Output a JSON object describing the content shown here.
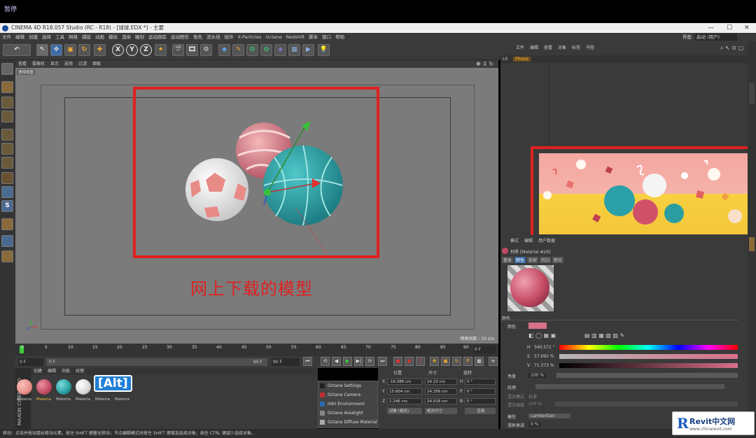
{
  "top": {
    "pause_label": "暂停"
  },
  "window": {
    "title": "CINEMA 4D R18.057 Studio (RC - R18) - [球球.EDX *] - 主要",
    "controls": [
      "—",
      "☐",
      "✕"
    ]
  },
  "menu": [
    "文件",
    "编辑",
    "创建",
    "选择",
    "工具",
    "网格",
    "捕捉",
    "动画",
    "模拟",
    "渲染",
    "雕刻",
    "运动跟踪",
    "运动图形",
    "角色",
    "流水线",
    "插件",
    "X-Particles",
    "Octane",
    "Redshift",
    "脚本",
    "窗口",
    "帮助"
  ],
  "layout": {
    "label": "界面",
    "value": "启动 (用户)"
  },
  "toolbar": {
    "axes": [
      "X",
      "Y",
      "Z"
    ]
  },
  "viewport": {
    "menu": [
      "查看",
      "摄像机",
      "显示",
      "选项",
      "过滤",
      "面板"
    ],
    "label": "透视视图",
    "annotation": "网上下载的模型",
    "grid_distance": "网格间距 : 10 cm"
  },
  "timeline": {
    "ticks": [
      "0",
      "5",
      "10",
      "15",
      "20",
      "25",
      "30",
      "35",
      "40",
      "45",
      "50",
      "55",
      "60",
      "65",
      "70",
      "75",
      "80",
      "85",
      "90"
    ],
    "end_frame": "0 F",
    "current_frame": "0 F",
    "min_frame": "0 F",
    "max_frame_a": "90 F",
    "max_frame_b": "90 F"
  },
  "materials": {
    "menu": [
      "创建",
      "编辑",
      "功能",
      "纹理"
    ],
    "items": [
      {
        "label": "Materia",
        "color": "#e8908a"
      },
      {
        "label": "Materia",
        "color": "#c44a64"
      },
      {
        "label": "Materia",
        "color": "#2a9ea0"
      },
      {
        "label": "Materia",
        "color": "#e8e8e8"
      },
      {
        "label": "Materia",
        "color": "#f0a860"
      },
      {
        "label": "Materia",
        "color": "#d8d8d8"
      }
    ],
    "alt_badge": "[Alt]",
    "brand_line1": "MAXON",
    "brand_line2": "CINEMA 4D"
  },
  "octane_menu": [
    "Octane Settings",
    "Octane Camera",
    "Hdri Environment",
    "Octane Arealight",
    "Octane Diffuse Material"
  ],
  "coords": {
    "headers": [
      "位置",
      "尺寸",
      "旋转"
    ],
    "rows": [
      {
        "axis": "X",
        "pos": "-16.086 cm",
        "size": "24.23 cm",
        "rot_axis": "H",
        "rot": "0 °"
      },
      {
        "axis": "Y",
        "pos": "15.604 cm",
        "size": "24.256 cm",
        "rot_axis": "P",
        "rot": "0 °"
      },
      {
        "axis": "Z",
        "pos": "1.246 cm",
        "size": "24.018 cm",
        "rot_axis": "B",
        "rot": "0 °"
      }
    ],
    "mode": "对象 (相对)",
    "size_mode": "绝对尺寸",
    "apply": "应用"
  },
  "objects": {
    "menu": [
      "文件",
      "编辑",
      "查看",
      "对象",
      "标签",
      "书签"
    ],
    "row_label": "L0",
    "row_name": "Phone"
  },
  "attributes": {
    "menu": [
      "模式",
      "编辑",
      "用户数据"
    ],
    "title": "材质 [Material #26]",
    "tabs": [
      "基本",
      "颜色",
      "反射",
      "凹凸",
      "辉光"
    ],
    "section": "颜色",
    "color_label": "颜色",
    "h_label": "H",
    "h_value": "340.571 °",
    "s_label": "S",
    "s_value": "57.692 %",
    "v_label": "V",
    "v_value": "71.373 %",
    "brightness_label": "亮度",
    "brightness_value": "100 %",
    "texture_label": "纹理",
    "mix_mode_label": "混合模式",
    "mix_mode_value": "标准",
    "mix_strength_label": "混合强度",
    "mix_strength_value": "100 %",
    "model_label": "模型",
    "model_value": "Lambertian",
    "diffuse_label": "漫射衰减",
    "diffuse_value": "0 %",
    "diffuse2_label": "漫射强度",
    "diffuse2_value": "100 %",
    "swatch_color": "#d8708a"
  },
  "status": "移动：点击并拖动鼠标移动元素。按住 SHIFT 键量化移动；节点编辑模式时按住 SHIFT 键增加选择对象；按住 CTRL 键减少选择对象。",
  "watermark": {
    "brand": "Revit中文网",
    "url": "www.chinarevit.com"
  },
  "colors": {
    "annotation_red": "#e02020",
    "ui_bg": "#3a3a3a",
    "accent": "#1e7fd6"
  }
}
